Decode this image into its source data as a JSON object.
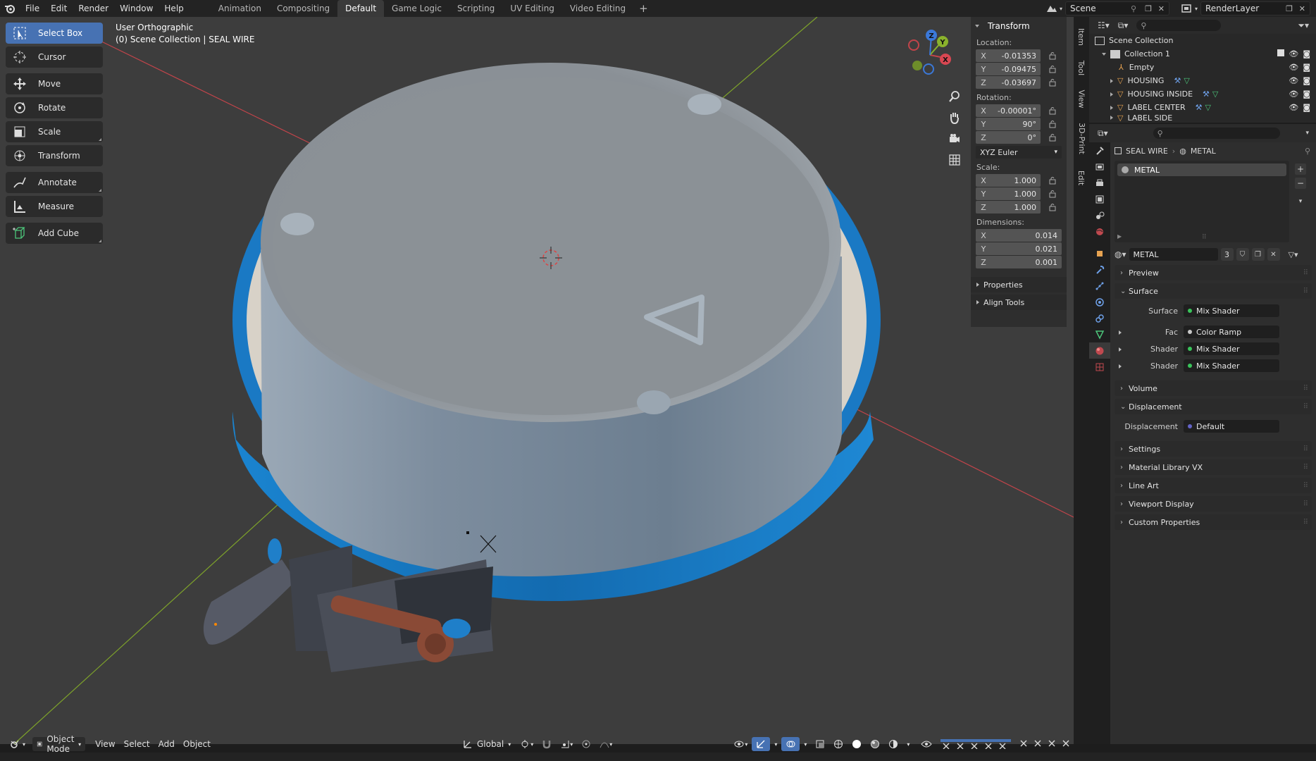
{
  "topbar": {
    "menus": [
      "File",
      "Edit",
      "Render",
      "Window",
      "Help"
    ],
    "workspaces": [
      "Animation",
      "Compositing",
      "Default",
      "Game Logic",
      "Scripting",
      "UV Editing",
      "Video Editing"
    ],
    "active_workspace": "Default",
    "scene": "Scene",
    "view_layer": "RenderLayer"
  },
  "toolbar": {
    "tools": [
      "Select Box",
      "Cursor",
      "Move",
      "Rotate",
      "Scale",
      "Transform",
      "Annotate",
      "Measure",
      "Add Cube"
    ],
    "active": "Select Box"
  },
  "viewport": {
    "view_name": "User Orthographic",
    "context": "(0) Scene Collection | SEAL WIRE",
    "gizmo_axes": [
      "X",
      "Y",
      "Z"
    ]
  },
  "npanel": {
    "tabs": [
      "Item",
      "Tool",
      "View",
      "3D-Print",
      "Edit"
    ],
    "transform_title": "Transform",
    "location_label": "Location:",
    "location": [
      {
        "axis": "X",
        "value": "-0.01353"
      },
      {
        "axis": "Y",
        "value": "-0.09475"
      },
      {
        "axis": "Z",
        "value": "-0.03697"
      }
    ],
    "rotation_label": "Rotation:",
    "rotation": [
      {
        "axis": "X",
        "value": "-0.00001°"
      },
      {
        "axis": "Y",
        "value": "90°"
      },
      {
        "axis": "Z",
        "value": "0°"
      }
    ],
    "rotation_mode": "XYZ Euler",
    "scale_label": "Scale:",
    "scale": [
      {
        "axis": "X",
        "value": "1.000"
      },
      {
        "axis": "Y",
        "value": "1.000"
      },
      {
        "axis": "Z",
        "value": "1.000"
      }
    ],
    "dimensions_label": "Dimensions:",
    "dimensions": [
      {
        "axis": "X",
        "value": "0.014"
      },
      {
        "axis": "Y",
        "value": "0.021"
      },
      {
        "axis": "Z",
        "value": "0.001"
      }
    ],
    "properties": "Properties",
    "align_tools": "Align Tools"
  },
  "footer": {
    "mode": "Object Mode",
    "menus": [
      "View",
      "Select",
      "Add",
      "Object"
    ],
    "orientation": "Global"
  },
  "outliner": {
    "root": "Scene Collection",
    "collection": "Collection 1",
    "items": [
      "Empty",
      "HOUSING",
      "HOUSING INSIDE",
      "LABEL CENTER",
      "LABEL SIDE"
    ]
  },
  "properties": {
    "breadcrumb_object": "SEAL WIRE",
    "breadcrumb_material": "METAL",
    "slot": "METAL",
    "material_name": "METAL",
    "user_count": "3",
    "panels": {
      "preview": "Preview",
      "surface": "Surface",
      "volume": "Volume",
      "displacement": "Displacement",
      "settings": "Settings",
      "material_library": "Material Library VX",
      "line_art": "Line Art",
      "viewport_display": "Viewport Display",
      "custom_properties": "Custom Properties"
    },
    "surface_rows": [
      {
        "label": "Surface",
        "value": "Mix Shader"
      },
      {
        "label": "Fac",
        "value": "Color Ramp"
      },
      {
        "label": "Shader",
        "value": "Mix Shader"
      },
      {
        "label": "Shader",
        "value": "Mix Shader"
      }
    ],
    "displacement_row": {
      "label": "Displacement",
      "value": "Default"
    }
  },
  "colors": {
    "accent": "#4772b3",
    "viewport_bg": "#3d3d3d",
    "ring_blue": "#1f7fc9",
    "x_axis": "#d4484f",
    "y_axis": "#8ab22c"
  }
}
